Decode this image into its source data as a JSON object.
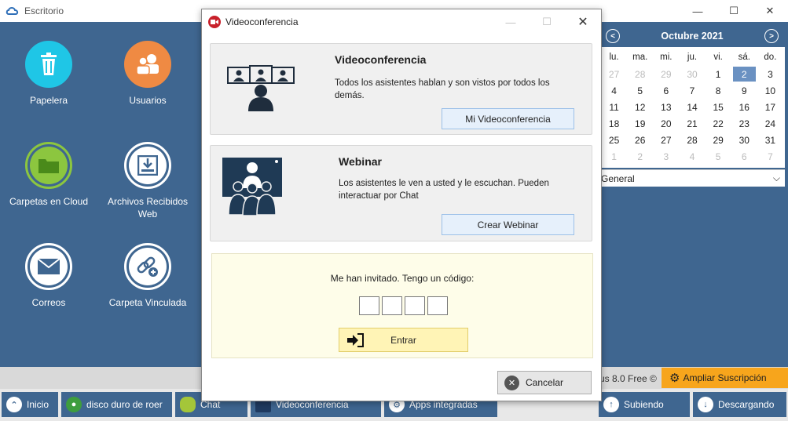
{
  "window": {
    "title": "Escritorio",
    "minimize": "—",
    "maximize": "☐",
    "close": "✕"
  },
  "desktop": {
    "icons": [
      {
        "label": "Papelera",
        "icon": "trash-icon",
        "color": "#1fc6e6"
      },
      {
        "label": "Usuarios",
        "icon": "users-icon",
        "color": "#ef8a43"
      },
      {
        "label": "Carpetas en Cloud",
        "icon": "folder-icon",
        "color": "#8cc63f"
      },
      {
        "label": "Archivos Recibidos Web",
        "icon": "inbox-icon",
        "color": "#ffffff"
      },
      {
        "label": "Correos",
        "icon": "mail-icon",
        "color": "#ffffff"
      },
      {
        "label": "Carpeta Vinculada",
        "icon": "link-icon",
        "color": "#ffffff"
      }
    ]
  },
  "calendar": {
    "month": "Octubre 2021",
    "weekdays": [
      "lu.",
      "ma.",
      "mi.",
      "ju.",
      "vi.",
      "sá.",
      "do."
    ],
    "rows": [
      [
        "27",
        "28",
        "29",
        "30",
        "1",
        "2",
        "3"
      ],
      [
        "4",
        "5",
        "6",
        "7",
        "8",
        "9",
        "10"
      ],
      [
        "11",
        "12",
        "13",
        "14",
        "15",
        "16",
        "17"
      ],
      [
        "18",
        "19",
        "20",
        "21",
        "22",
        "23",
        "24"
      ],
      [
        "25",
        "26",
        "27",
        "28",
        "29",
        "30",
        "31"
      ],
      [
        "1",
        "2",
        "3",
        "4",
        "5",
        "6",
        "7"
      ]
    ],
    "selected_day": "2",
    "filter_value": "General"
  },
  "status": {
    "version_text": "us 8.0 Free ©",
    "upgrade_label": "Ampliar Suscripción"
  },
  "taskbar": {
    "items": [
      {
        "label": "Inicio"
      },
      {
        "label": "disco duro de roer"
      },
      {
        "label": "Chat"
      },
      {
        "label": "Videoconferencia"
      },
      {
        "label": "Apps integradas"
      },
      {
        "label": "Subiendo"
      },
      {
        "label": "Descargando"
      }
    ]
  },
  "dialog": {
    "title": "Videoconferencia",
    "video": {
      "heading": "Videoconferencia",
      "description": "Todos los asistentes hablan y son vistos por todos los demás.",
      "button": "Mi Videoconferencia"
    },
    "webinar": {
      "heading": "Webinar",
      "description": "Los asistentes le ven a usted y le escuchan. Pueden interactuar por Chat",
      "button": "Crear Webinar"
    },
    "invite": {
      "label": "Me han invitado. Tengo un código:",
      "enter_button": "Entrar"
    },
    "cancel_button": "Cancelar"
  },
  "colors": {
    "desktop_bg": "#3f6690",
    "accent_orange": "#f7a51c",
    "invite_bg": "#fefde9",
    "primary_btn_bg": "#e6f0fb"
  }
}
